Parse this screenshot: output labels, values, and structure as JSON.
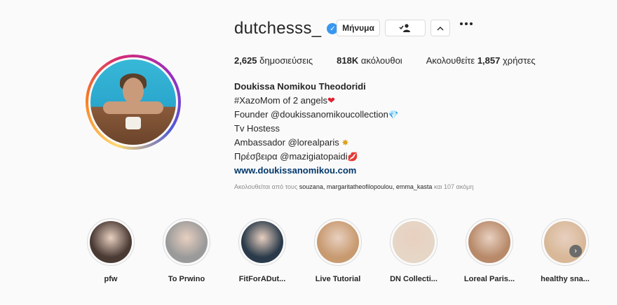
{
  "profile": {
    "username": "dutchesss_",
    "verified_icon": "verified-badge-icon",
    "message_label": "Μήνυμα",
    "follow_icon": "person-check-icon",
    "chevron_icon": "chevron-up-icon",
    "more_icon": "more-options-icon"
  },
  "stats": {
    "posts_count": "2,625",
    "posts_label": "δημοσιεύσεις",
    "followers_count": "818K",
    "followers_label": "ακόλουθοι",
    "following_prefix": "Ακολουθείτε",
    "following_count": "1,857",
    "following_suffix": "χρήστες"
  },
  "bio": {
    "name": "Doukissa Nomikou Theodoridi",
    "line1": "#XazoMom of 2 angels",
    "line1_emoji": "❤",
    "line2": "Founder @doukissanomikoucollection",
    "line2_emoji": "💎",
    "line3": "Tv Hostess",
    "line4": "Ambassador @lorealparis",
    "line4_emoji": "✸",
    "line5": "Πρέσβειρα @mazigiatopaidi",
    "line5_emoji": "💋",
    "website": "www.doukissanomikou.com"
  },
  "followed_by": {
    "prefix": "Ακολουθείται από τους",
    "users": "souzana, margaritatheofilopoulou, emma_kasta",
    "suffix": "και 107 ακόμη"
  },
  "highlights": [
    {
      "label": "pfw",
      "color": "#4a3a34"
    },
    {
      "label": "To Prwino",
      "color": "#9a9a9a"
    },
    {
      "label": "FitForADut...",
      "color": "#2a3a4a"
    },
    {
      "label": "Live Tutorial",
      "color": "#c89a70"
    },
    {
      "label": "DN Collecti...",
      "color": "#e6d6c6"
    },
    {
      "label": "Loreal Paris...",
      "color": "#b88a6a"
    },
    {
      "label": "healthy sna...",
      "color": "#d8b898"
    }
  ],
  "next_icon": "chevron-right-icon"
}
